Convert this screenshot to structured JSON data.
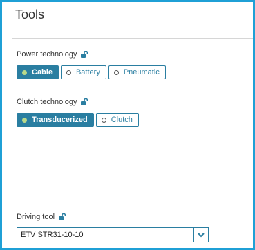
{
  "window": {
    "title": "Tools"
  },
  "sections": {
    "power": {
      "label": "Power technology",
      "options": [
        "Cable",
        "Battery",
        "Pneumatic"
      ],
      "selected": "Cable"
    },
    "clutch": {
      "label": "Clutch technology",
      "options": [
        "Transducerized",
        "Clutch"
      ],
      "selected": "Transducerized"
    },
    "driving": {
      "label": "Driving tool",
      "value": "ETV STR31-10-10"
    }
  },
  "colors": {
    "frame_border": "#1fa0d6",
    "accent": "#2a7ea1",
    "selected_dot": "#b9d98a"
  },
  "icons": {
    "lock": "lock-open-icon",
    "dropdown": "chevron-down-icon"
  }
}
